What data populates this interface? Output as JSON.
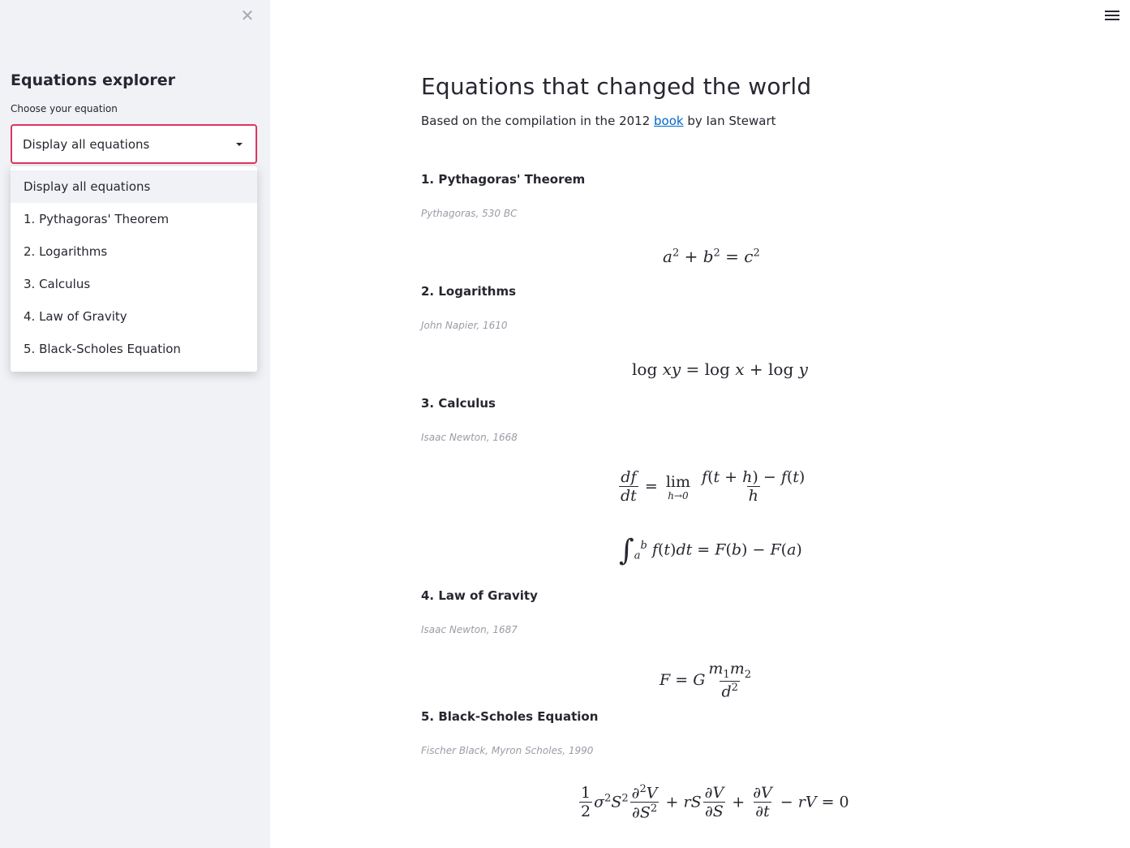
{
  "sidebar": {
    "close_icon": "close-icon",
    "title": "Equations explorer",
    "select_label": "Choose your equation",
    "selected": "Display all equations",
    "options": [
      "Display all equations",
      "1. Pythagoras' Theorem",
      "2. Logarithms",
      "3. Calculus",
      "4. Law of Gravity",
      "5. Black-Scholes Equation"
    ],
    "accent": "#e0335f"
  },
  "header": {
    "menu_icon": "hamburger-menu-icon"
  },
  "main": {
    "title": "Equations that changed the world",
    "subtitle_prefix": "Based on the compilation in the 2012 ",
    "subtitle_link": "book",
    "subtitle_suffix": " by Ian Stewart",
    "link_color": "#0068c9",
    "equations": [
      {
        "heading": "1. Pythagoras' Theorem",
        "attribution": "Pythagoras, 530 BC"
      },
      {
        "heading": "2. Logarithms",
        "attribution": "John Napier, 1610"
      },
      {
        "heading": "3. Calculus",
        "attribution": "Isaac Newton, 1668"
      },
      {
        "heading": "4. Law of Gravity",
        "attribution": "Isaac Newton, 1687"
      },
      {
        "heading": "5. Black-Scholes Equation",
        "attribution": "Fischer Black, Myron Scholes, 1990"
      }
    ]
  }
}
